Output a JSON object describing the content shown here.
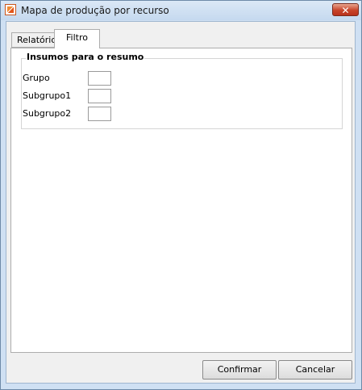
{
  "window": {
    "title": "Mapa de produção por recurso",
    "close_symbol": "✕"
  },
  "tabs": [
    {
      "label": "Relatório",
      "active": false
    },
    {
      "label": "Filtro",
      "active": true
    }
  ],
  "filter_group": {
    "title": "Insumos para o resumo",
    "fields": [
      {
        "label": "Grupo",
        "value": ""
      },
      {
        "label": "Subgrupo1",
        "value": ""
      },
      {
        "label": "Subgrupo2",
        "value": ""
      }
    ]
  },
  "buttons": {
    "confirm_label": "Confirmar",
    "cancel_label": "Cancelar"
  },
  "colors": {
    "close_button": "#c8442a",
    "frame": "#cfe0f3",
    "app_icon": "#f28b32"
  },
  "icons": [
    "app-icon",
    "close-icon"
  ]
}
